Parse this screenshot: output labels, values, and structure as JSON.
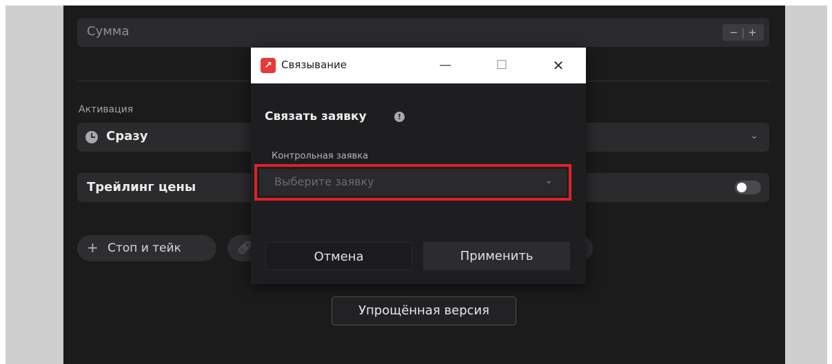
{
  "form": {
    "sum_label": "Сумма",
    "stepper_minus": "−",
    "stepper_plus": "+",
    "activation_label": "Активация",
    "activation_value": "Сразу",
    "trailing_label": "Трейлинг цены",
    "stop_take_plus": "+",
    "stop_take_label": "Стоп и тейк",
    "simple_version_label": "Упрощённая версия"
  },
  "dialog": {
    "app_icon_glyph": "↗",
    "window_title": "Связывание",
    "heading": "Связать заявку",
    "info_glyph": "!",
    "control_label": "Контрольная заявка",
    "select_placeholder": "Выберите заявку",
    "cancel_label": "Отмена",
    "apply_label": "Применить"
  },
  "icons": {
    "chevron": "⌄",
    "minimize": "—",
    "maximize": "☐",
    "close": "✕",
    "link": "🔗"
  },
  "colors": {
    "app_bg": "#1b1b1c",
    "highlight_outline": "#e0202a",
    "brand_icon": "#e8393a"
  }
}
